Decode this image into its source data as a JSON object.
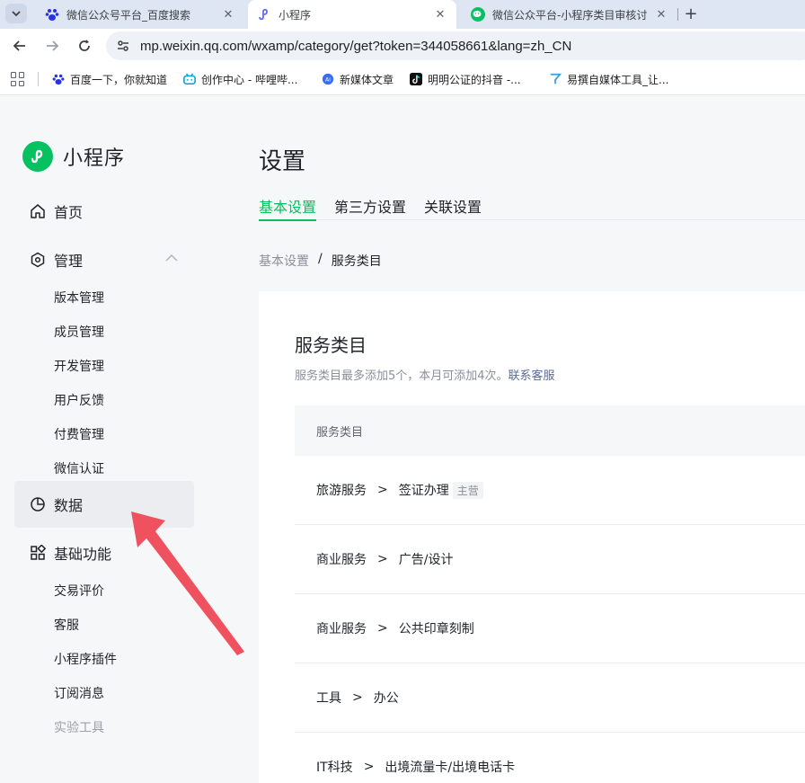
{
  "browser": {
    "tabs": [
      {
        "title": "微信公众号平台_百度搜索",
        "icon": "baidu-paw-icon"
      },
      {
        "title": "小程序",
        "icon": "miniprogram-icon",
        "active": true
      },
      {
        "title": "微信公众平台-小程序类目审核讨",
        "icon": "wechat-icon"
      }
    ],
    "url": "mp.weixin.qq.com/wxamp/category/get?token=344058661&lang=zh_CN",
    "bookmarks": [
      {
        "label": "百度一下，你就知道",
        "icon": "baidu-paw-icon"
      },
      {
        "label": "创作中心 - 哔哩哔...",
        "icon": "bilibili-icon"
      },
      {
        "label": "新媒体文章",
        "icon": "ai-icon"
      },
      {
        "label": "明明公证的抖音 -...",
        "icon": "tiktok-icon"
      },
      {
        "label": "易撰自媒体工具_让...",
        "icon": "yizhuan-icon"
      }
    ]
  },
  "sidebar": {
    "brand": "小程序",
    "home": "首页",
    "manage": "管理",
    "manage_items": [
      "版本管理",
      "成员管理",
      "开发管理",
      "用户反馈",
      "付费管理",
      "微信认证"
    ],
    "data": "数据",
    "basic": "基础功能",
    "basic_items": [
      "交易评价",
      "客服",
      "小程序插件",
      "订阅消息",
      "实验工具"
    ]
  },
  "main": {
    "title": "设置",
    "tabs": [
      "基本设置",
      "第三方设置",
      "关联设置"
    ],
    "breadcrumb": {
      "parent": "基本设置",
      "separator": "/",
      "current": "服务类目"
    },
    "card": {
      "title": "服务类目",
      "desc": "服务类目最多添加5个，本月可添加4次。",
      "desc_link": "联系客服",
      "column": "服务类目",
      "rows": [
        {
          "cat": "旅游服务",
          "sub": "签证办理",
          "tag": "主营"
        },
        {
          "cat": "商业服务",
          "sub": "广告/设计"
        },
        {
          "cat": "商业服务",
          "sub": "公共印章刻制"
        },
        {
          "cat": "工具",
          "sub": "办公"
        },
        {
          "cat": "IT科技",
          "sub": "出境流量卡/出境电话卡"
        }
      ],
      "arrow_symbol": ">"
    }
  },
  "colors": {
    "accent": "#07c160",
    "link": "#576b95",
    "annotation_arrow": "#f0515f"
  }
}
